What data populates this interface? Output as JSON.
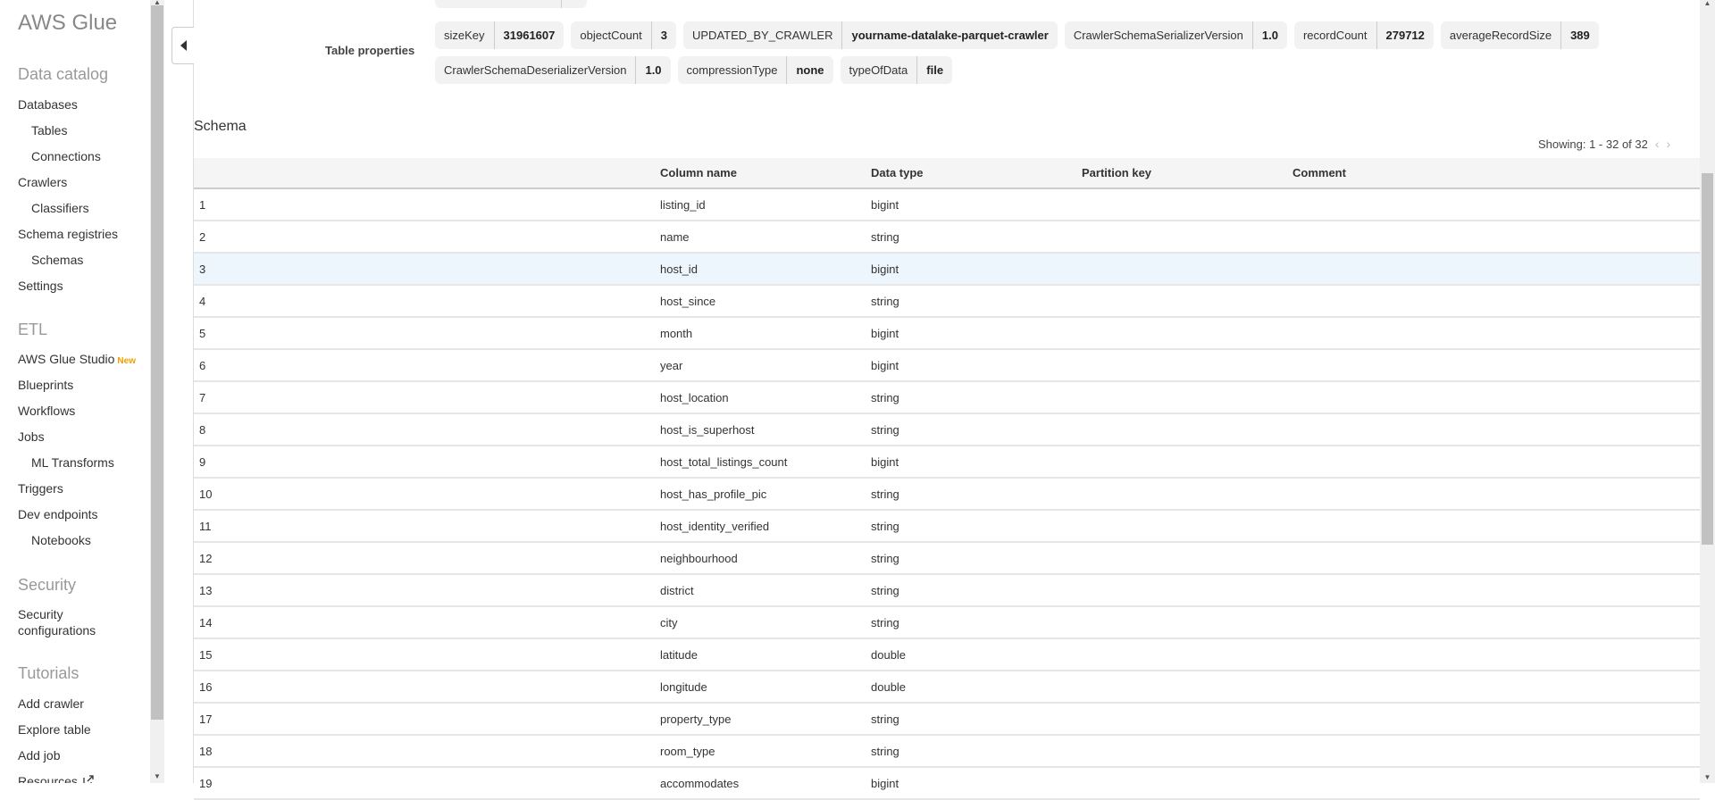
{
  "sidebar": {
    "brand": "AWS Glue",
    "sections": {
      "data_catalog": "Data catalog",
      "etl": "ETL",
      "security": "Security",
      "tutorials": "Tutorials"
    },
    "items": {
      "databases": "Databases",
      "tables": "Tables",
      "connections": "Connections",
      "crawlers": "Crawlers",
      "classifiers": "Classifiers",
      "schema_registries": "Schema registries",
      "schemas": "Schemas",
      "settings": "Settings",
      "glue_studio": "AWS Glue Studio",
      "glue_studio_badge": "New",
      "blueprints": "Blueprints",
      "workflows": "Workflows",
      "jobs": "Jobs",
      "ml_transforms": "ML Transforms",
      "triggers": "Triggers",
      "dev_endpoints": "Dev endpoints",
      "notebooks": "Notebooks",
      "security_configurations_1": "Security",
      "security_configurations_2": "configurations",
      "add_crawler": "Add crawler",
      "explore_table": "Explore table",
      "add_job": "Add job",
      "resources": "Resources"
    },
    "icons": {
      "resources": "external-link-icon"
    }
  },
  "table_properties": {
    "label": "Table properties",
    "rows": [
      [
        {
          "key": "sizeKey",
          "value": "31961607"
        },
        {
          "key": "objectCount",
          "value": "3"
        },
        {
          "key": "UPDATED_BY_CRAWLER",
          "value": "yourname-datalake-parquet-crawler"
        },
        {
          "key": "CrawlerSchemaSerializerVersion",
          "value": "1.0"
        },
        {
          "key": "recordCount",
          "value": "279712"
        },
        {
          "key": "averageRecordSize",
          "value": "389"
        }
      ],
      [
        {
          "key": "CrawlerSchemaDeserializerVersion",
          "value": "1.0"
        },
        {
          "key": "compressionType",
          "value": "none"
        },
        {
          "key": "typeOfData",
          "value": "file"
        }
      ]
    ]
  },
  "schema": {
    "title": "Schema",
    "showing": "Showing: 1 - 32 of 32",
    "prev_icon": "‹",
    "next_icon": "›",
    "columns": [
      "",
      "Column name",
      "Data type",
      "Partition key",
      "Comment"
    ],
    "highlighted_row": 3,
    "rows": [
      {
        "n": "1",
        "name": "listing_id",
        "type": "bigint",
        "partition": "",
        "comment": ""
      },
      {
        "n": "2",
        "name": "name",
        "type": "string",
        "partition": "",
        "comment": ""
      },
      {
        "n": "3",
        "name": "host_id",
        "type": "bigint",
        "partition": "",
        "comment": ""
      },
      {
        "n": "4",
        "name": "host_since",
        "type": "string",
        "partition": "",
        "comment": ""
      },
      {
        "n": "5",
        "name": "month",
        "type": "bigint",
        "partition": "",
        "comment": ""
      },
      {
        "n": "6",
        "name": "year",
        "type": "bigint",
        "partition": "",
        "comment": ""
      },
      {
        "n": "7",
        "name": "host_location",
        "type": "string",
        "partition": "",
        "comment": ""
      },
      {
        "n": "8",
        "name": "host_is_superhost",
        "type": "string",
        "partition": "",
        "comment": ""
      },
      {
        "n": "9",
        "name": "host_total_listings_count",
        "type": "bigint",
        "partition": "",
        "comment": ""
      },
      {
        "n": "10",
        "name": "host_has_profile_pic",
        "type": "string",
        "partition": "",
        "comment": ""
      },
      {
        "n": "11",
        "name": "host_identity_verified",
        "type": "string",
        "partition": "",
        "comment": ""
      },
      {
        "n": "12",
        "name": "neighbourhood",
        "type": "string",
        "partition": "",
        "comment": ""
      },
      {
        "n": "13",
        "name": "district",
        "type": "string",
        "partition": "",
        "comment": ""
      },
      {
        "n": "14",
        "name": "city",
        "type": "string",
        "partition": "",
        "comment": ""
      },
      {
        "n": "15",
        "name": "latitude",
        "type": "double",
        "partition": "",
        "comment": ""
      },
      {
        "n": "16",
        "name": "longitude",
        "type": "double",
        "partition": "",
        "comment": ""
      },
      {
        "n": "17",
        "name": "property_type",
        "type": "string",
        "partition": "",
        "comment": ""
      },
      {
        "n": "18",
        "name": "room_type",
        "type": "string",
        "partition": "",
        "comment": ""
      },
      {
        "n": "19",
        "name": "accommodates",
        "type": "bigint",
        "partition": "",
        "comment": ""
      }
    ]
  },
  "colors": {
    "new_badge": "#f0a000",
    "row_highlight": "#eef6fd",
    "tag_bg": "#f2f2f2"
  }
}
